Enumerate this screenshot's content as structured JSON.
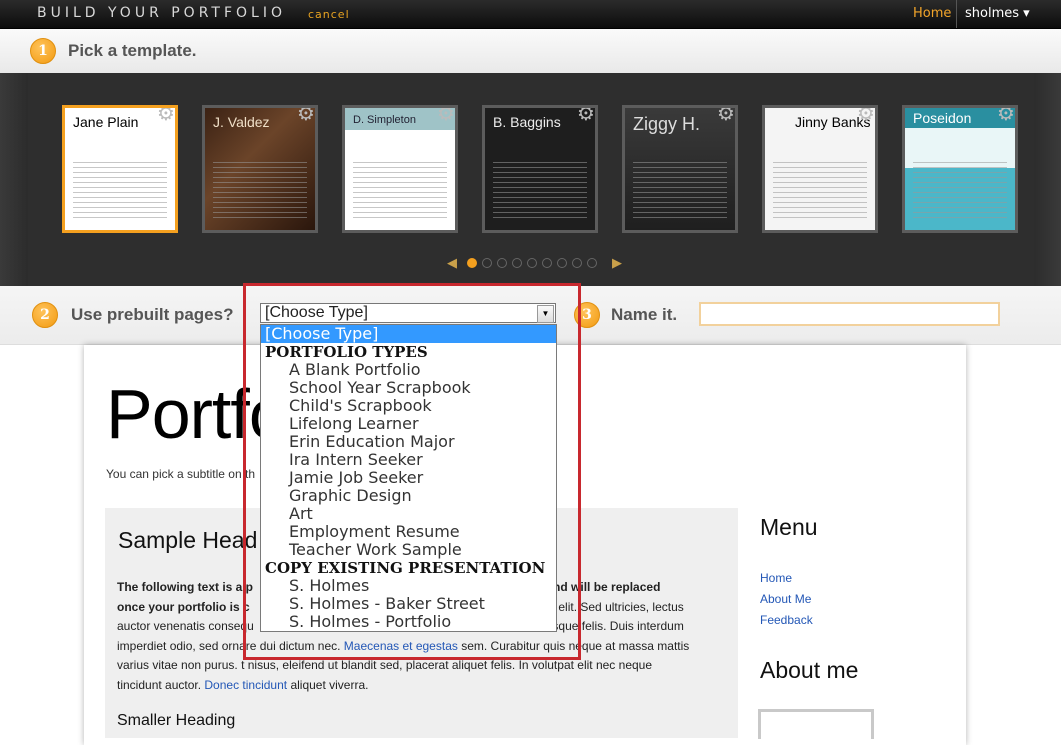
{
  "topbar": {
    "brand": "BUILD YOUR PORTFOLIO",
    "cancel": "cancel",
    "home": "Home",
    "user": "sholmes ▾"
  },
  "step1": {
    "number": "1",
    "label": "Pick a template."
  },
  "templates": [
    {
      "name": "Jane Plain",
      "selected": true
    },
    {
      "name": "J. Valdez"
    },
    {
      "name": "D. Simpleton"
    },
    {
      "name": "B. Baggins"
    },
    {
      "name": "Ziggy H."
    },
    {
      "name": "Jinny Banks"
    },
    {
      "name": "Poseidon"
    }
  ],
  "pager": {
    "pages": 9,
    "active": 0,
    "prev": "◀",
    "next": "▶"
  },
  "step2": {
    "number": "2",
    "label": "Use prebuilt pages?",
    "select_value": "[Choose Type]"
  },
  "step3": {
    "number": "3",
    "label": "Name it.",
    "name_value": ""
  },
  "dropdown": {
    "options": [
      {
        "label": "[Choose Type]",
        "highlight": true
      },
      {
        "label": "PORTFOLIO TYPES",
        "group": true
      },
      {
        "label": "A Blank Portfolio"
      },
      {
        "label": "School Year Scrapbook"
      },
      {
        "label": "Child's Scrapbook"
      },
      {
        "label": "Lifelong Learner"
      },
      {
        "label": "Erin Education Major"
      },
      {
        "label": "Ira Intern Seeker"
      },
      {
        "label": "Jamie Job Seeker"
      },
      {
        "label": "Graphic Design"
      },
      {
        "label": "Art"
      },
      {
        "label": "Employment Resume"
      },
      {
        "label": "Teacher Work Sample"
      },
      {
        "label": "COPY EXISTING PRESENTATION",
        "group": true
      },
      {
        "label": "S. Holmes"
      },
      {
        "label": "S. Holmes - Baker Street"
      },
      {
        "label": "S. Holmes - Portfolio"
      }
    ]
  },
  "preview": {
    "title": "Portfo",
    "subtitle": "You can pick a subtitle on th",
    "sample_heading": "Sample Head",
    "body_bold": "The following text is a p",
    "body_bold2": "olate and will be replaced",
    "body_bold3": "once your portfolio is c",
    "body_l2": "piscing elit. Sed ultricies, lectus",
    "body_l3a": "auctor venenatis consequ",
    "body_l3b": "risque felis. Duis interdum",
    "body_l4a": "imperdiet odio, sed ornare dui dictum nec. ",
    "body_link1": "Maecenas et egestas",
    "body_l4b": " sem. Curabitur quis neque at massa mattis",
    "body_l5a": "varius vitae non purus. ",
    "body_l5b": "t nisus, eleifend ut blandit sed, placerat aliquet felis. In volutpat elit nec neque",
    "body_l6a": "tincidunt auctor. ",
    "body_link2": "Donec tincidunt",
    "body_l6b": " aliquet viverra.",
    "smaller_heading": "Smaller Heading",
    "menu_heading": "Menu",
    "menu_links": [
      "Home",
      "About Me",
      "Feedback"
    ],
    "about_heading": "About me"
  }
}
